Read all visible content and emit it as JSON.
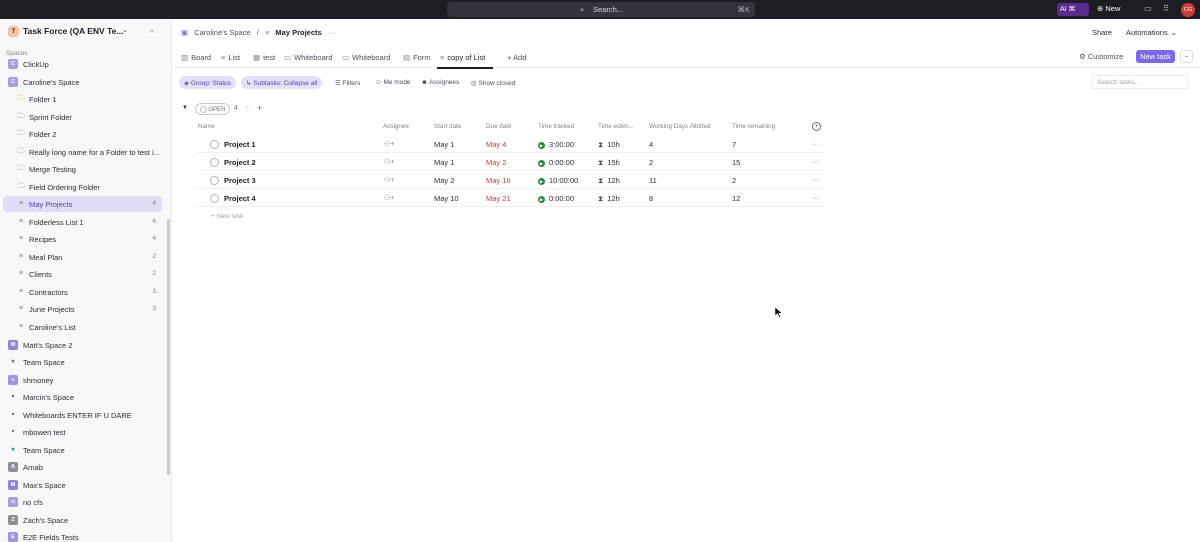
{
  "topbar": {
    "search_label": "Search...",
    "search_shortcut": "⌘K",
    "ai_label": "AI ⌘",
    "new_label": "New",
    "avatar_initials": "CG"
  },
  "sidebar": {
    "workspace_logo": "T",
    "workspace_name": "Task Force (QA ENV Te...",
    "spaces_label": "Spaces",
    "items": [
      {
        "label": "ClickUp",
        "icon": "C",
        "count": ""
      },
      {
        "label": "Caroline's Space",
        "icon": "C",
        "count": ""
      },
      {
        "label": "Folder 1",
        "icon": "folder-icon",
        "count": ""
      },
      {
        "label": "Sprint Folder",
        "icon": "sprint-folder-icon",
        "count": ""
      },
      {
        "label": "Folder 2",
        "icon": "folder-icon",
        "count": ""
      },
      {
        "label": "Really long name for a Folder to test i...",
        "icon": "folder-icon",
        "count": ""
      },
      {
        "label": "Merge Testing",
        "icon": "folder-icon",
        "count": ""
      },
      {
        "label": "Field Ordering Folder",
        "icon": "folder-icon",
        "count": ""
      },
      {
        "label": "May Projects",
        "icon": "list-icon",
        "count": "4"
      },
      {
        "label": "Folderless List 1",
        "icon": "list-icon",
        "count": "6"
      },
      {
        "label": "Recipes",
        "icon": "list-icon",
        "count": "4"
      },
      {
        "label": "Meal Plan",
        "icon": "list-icon",
        "count": "2"
      },
      {
        "label": "Clients",
        "icon": "list-icon",
        "count": "2"
      },
      {
        "label": "Contractors",
        "icon": "list-icon",
        "count": "3"
      },
      {
        "label": "June Projects",
        "icon": "list-icon",
        "count": "3"
      },
      {
        "label": "Caroline's List",
        "icon": "list-icon",
        "count": ""
      },
      {
        "label": "Matt's Space 2",
        "icon": "M",
        "count": ""
      },
      {
        "label": "Team Space",
        "icon": "globe-icon",
        "count": ""
      },
      {
        "label": "shmoney",
        "icon": "s",
        "count": ""
      },
      {
        "label": "Marcin's Space",
        "icon": "image-avatar-icon",
        "count": ""
      },
      {
        "label": "Whiteboards ENTER IF U DARE",
        "icon": "image-avatar-icon",
        "count": ""
      },
      {
        "label": "mbowen test",
        "icon": "image-avatar-icon",
        "count": ""
      },
      {
        "label": "Team Space",
        "icon": "globe-icon",
        "count": ""
      },
      {
        "label": "Arnab",
        "icon": "A",
        "count": ""
      },
      {
        "label": "Max's Space",
        "icon": "M",
        "count": ""
      },
      {
        "label": "no cfs",
        "icon": "n",
        "count": ""
      },
      {
        "label": "Zach's Space",
        "icon": "Z",
        "count": ""
      },
      {
        "label": "E2E Fields Tests",
        "icon": "E",
        "count": ""
      }
    ]
  },
  "header": {
    "breadcrumb_space": "Caroline's Space",
    "breadcrumb_sep": "/",
    "breadcrumb_list": "May Projects",
    "share_label": "Share",
    "automations_label": "Automations"
  },
  "views": {
    "tabs": [
      "Board",
      "List",
      "test",
      "Whiteboard",
      "Whiteboard",
      "Form",
      "copy of List"
    ],
    "add_label": "+ Add",
    "customize_label": "Customize",
    "new_task_label": "New task"
  },
  "toolbar": {
    "group_chip": "Group: Status",
    "subtasks_chip": "Subtasks: Collapse all",
    "filters_label": "Filters",
    "me_mode_label": "Me mode",
    "assignees_label": "Assignees",
    "show_closed_label": "Show closed",
    "search_placeholder": "Search tasks..."
  },
  "group": {
    "status": "OPEN",
    "count": "4"
  },
  "columns": [
    "Name",
    "Assignee",
    "Start date",
    "Due date",
    "Time tracked",
    "Time estim...",
    "Working Days Allotted",
    "Time remaining"
  ],
  "tasks": [
    {
      "name": "Project 1",
      "start": "May 1",
      "due": "May 4",
      "tracked": "3:00:00",
      "estimate": "10h",
      "allotted": "4",
      "remaining": "7"
    },
    {
      "name": "Project 2",
      "start": "May 1",
      "due": "May 2",
      "tracked": "0:00:00",
      "estimate": "15h",
      "allotted": "2",
      "remaining": "15"
    },
    {
      "name": "Project 3",
      "start": "May 2",
      "due": "May 16",
      "tracked": "10:00:00",
      "estimate": "12h",
      "allotted": "11",
      "remaining": "2"
    },
    {
      "name": "Project 4",
      "start": "May 10",
      "due": "May 21",
      "tracked": "0:00:00",
      "estimate": "12h",
      "allotted": "8",
      "remaining": "12"
    }
  ],
  "new_task_row_label": "New task",
  "colors": {
    "accent": "#7b68ee",
    "due_red": "#c23b3b",
    "timer_green": "#1f8a3a",
    "active_sidebar": "#e1ddf7"
  }
}
